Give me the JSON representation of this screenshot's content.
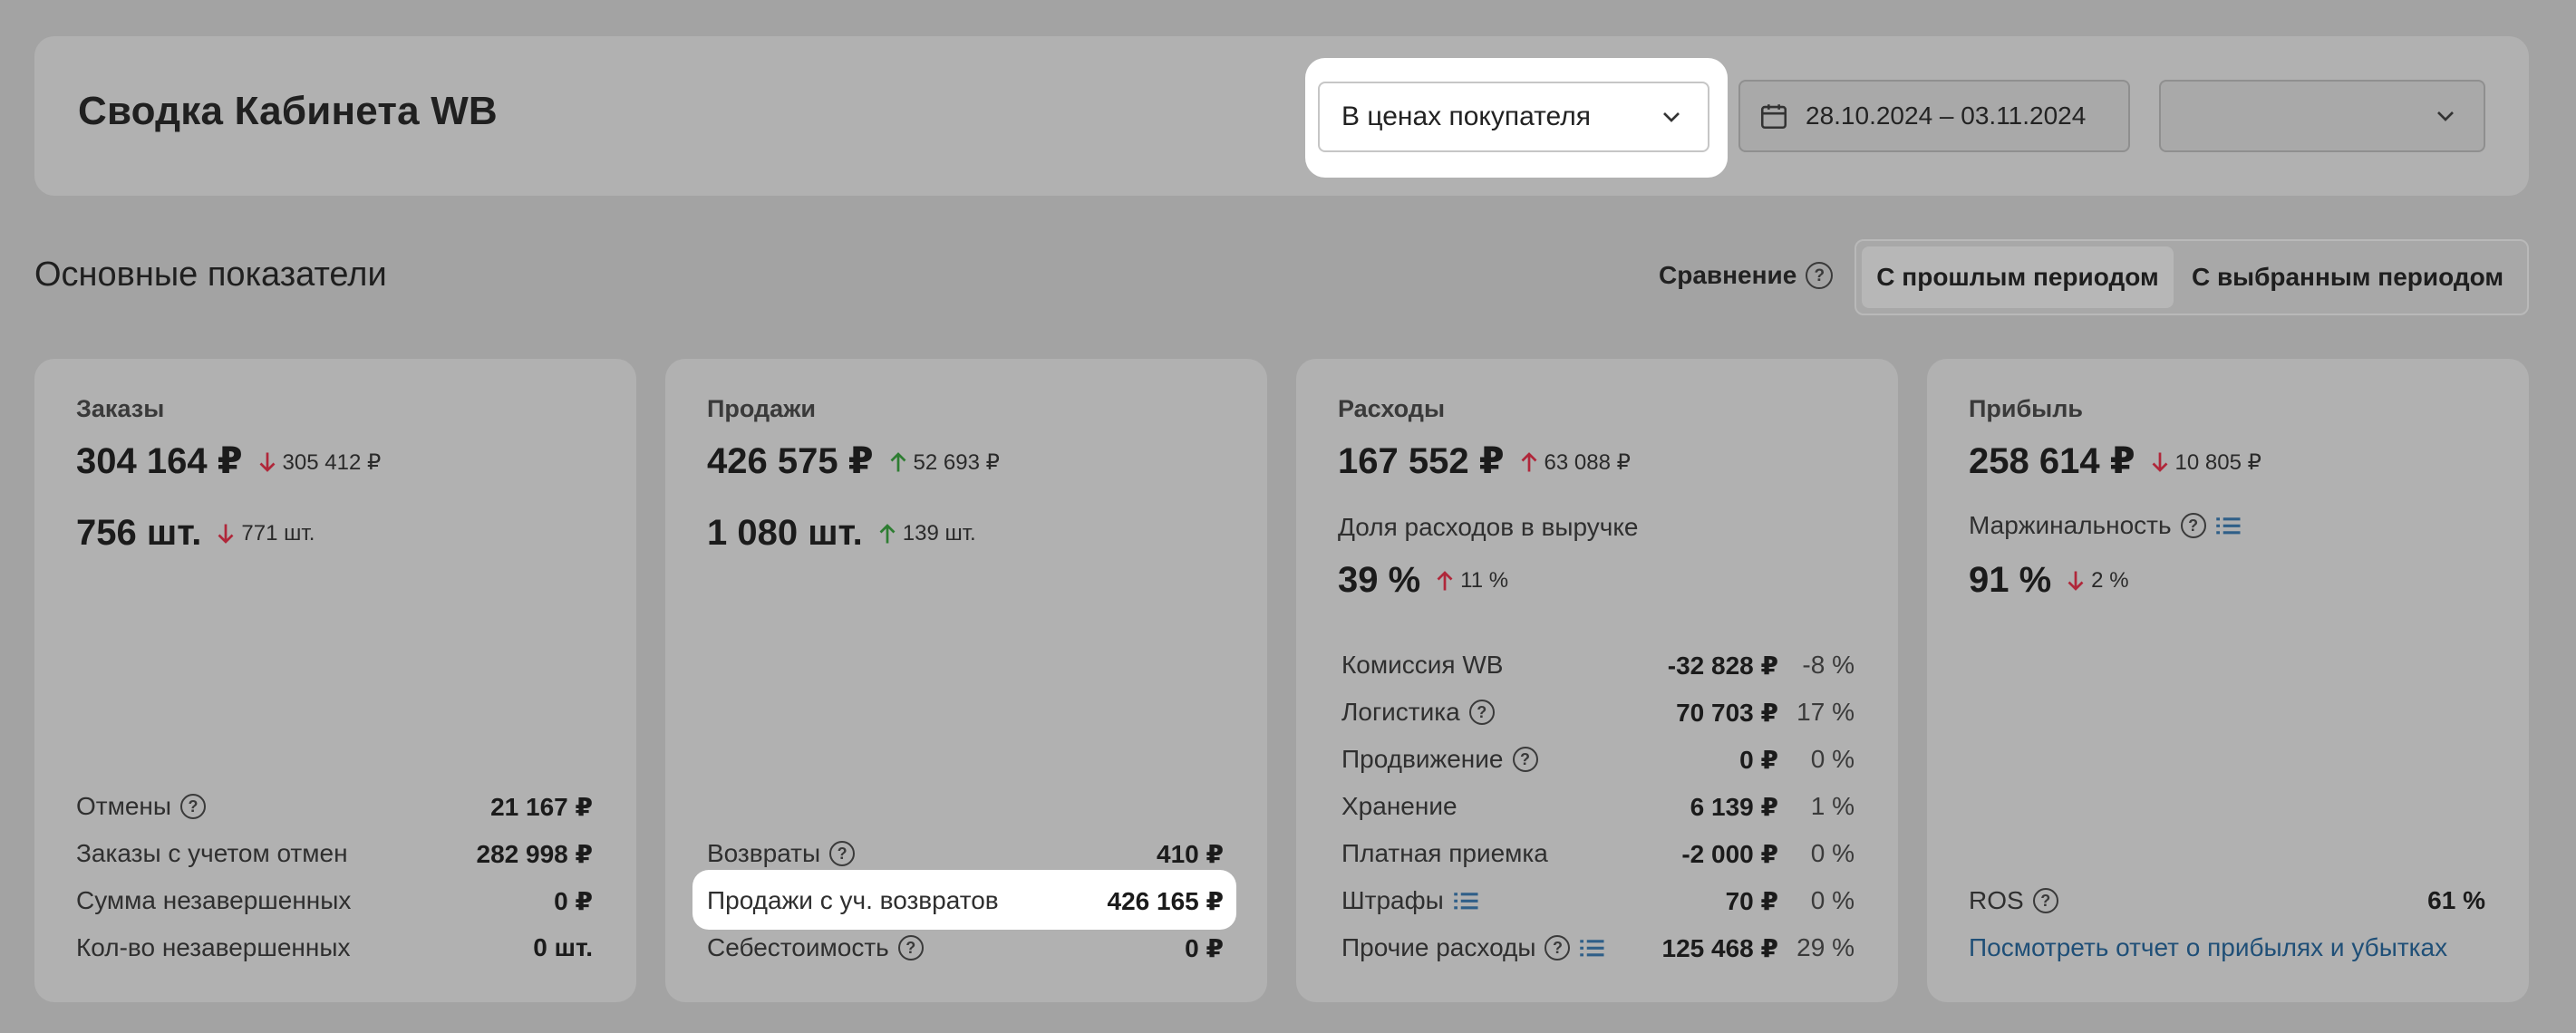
{
  "header": {
    "title": "Сводка Кабинета WB",
    "price_mode": "В ценах покупателя",
    "date_range": "28.10.2024 – 03.11.2024",
    "extra_select": ""
  },
  "section": {
    "title": "Основные показатели",
    "compare_label": "Сравнение",
    "compare_options": [
      "С прошлым периодом",
      "С выбранным периодом"
    ],
    "compare_selected": "С прошлым периодом"
  },
  "colors": {
    "up": "#2e7d32",
    "down": "#b0273a",
    "link": "#1f4f77",
    "highlight": "#ffffff"
  },
  "cards": {
    "orders": {
      "title": "Заказы",
      "amount": "304 164 ₽",
      "amount_delta": "305 412 ₽",
      "amount_trend": "down",
      "qty": "756 шт.",
      "qty_delta": "771 шт.",
      "qty_trend": "down",
      "rows": [
        {
          "label": "Отмены",
          "value": "21 167 ₽",
          "help": true
        },
        {
          "label": "Заказы с учетом отмен",
          "value": "282 998 ₽",
          "help": false
        },
        {
          "label": "Сумма незавершенных",
          "value": "0 ₽",
          "help": false
        },
        {
          "label": "Кол-во незавершенных",
          "value": "0 шт.",
          "help": false
        }
      ]
    },
    "sales": {
      "title": "Продажи",
      "amount": "426 575 ₽",
      "amount_delta": "52 693 ₽",
      "amount_trend": "up",
      "qty": "1 080 шт.",
      "qty_delta": "139 шт.",
      "qty_trend": "up",
      "rows": [
        {
          "label": "Возвраты",
          "value": "410 ₽",
          "help": true
        },
        {
          "label": "Продажи с уч. возвратов",
          "value": "426 165 ₽",
          "help": false
        },
        {
          "label": "Себестоимость",
          "value": "0 ₽",
          "help": true
        }
      ]
    },
    "expenses": {
      "title": "Расходы",
      "amount": "167 552 ₽",
      "amount_delta": "63 088 ₽",
      "amount_trend": "up",
      "share_label": "Доля расходов в выручке",
      "share": "39 %",
      "share_delta": "11 %",
      "share_trend": "up",
      "rows": [
        {
          "label": "Комиссия WB",
          "value": "-32 828 ₽",
          "pct": "-8 %"
        },
        {
          "label": "Логистика",
          "value": "70 703 ₽",
          "pct": "17 %"
        },
        {
          "label": "Продвижение",
          "value": "0 ₽",
          "pct": "0 %"
        },
        {
          "label": "Хранение",
          "value": "6 139 ₽",
          "pct": "1 %"
        },
        {
          "label": "Платная приемка",
          "value": "-2 000 ₽",
          "pct": "0 %"
        },
        {
          "label": "Штрафы",
          "value": "70 ₽",
          "pct": "0 %"
        },
        {
          "label": "Прочие расходы",
          "value": "125 468 ₽",
          "pct": "29 %"
        }
      ]
    },
    "profit": {
      "title": "Прибыль",
      "amount": "258 614 ₽",
      "amount_delta": "10 805 ₽",
      "amount_trend": "down",
      "margin_label": "Маржинальность",
      "margin": "91 %",
      "margin_delta": "2 %",
      "margin_trend": "down",
      "ros_label": "ROS",
      "ros_value": "61 %",
      "report_link": "Посмотреть отчет о прибылях и убытках"
    }
  }
}
